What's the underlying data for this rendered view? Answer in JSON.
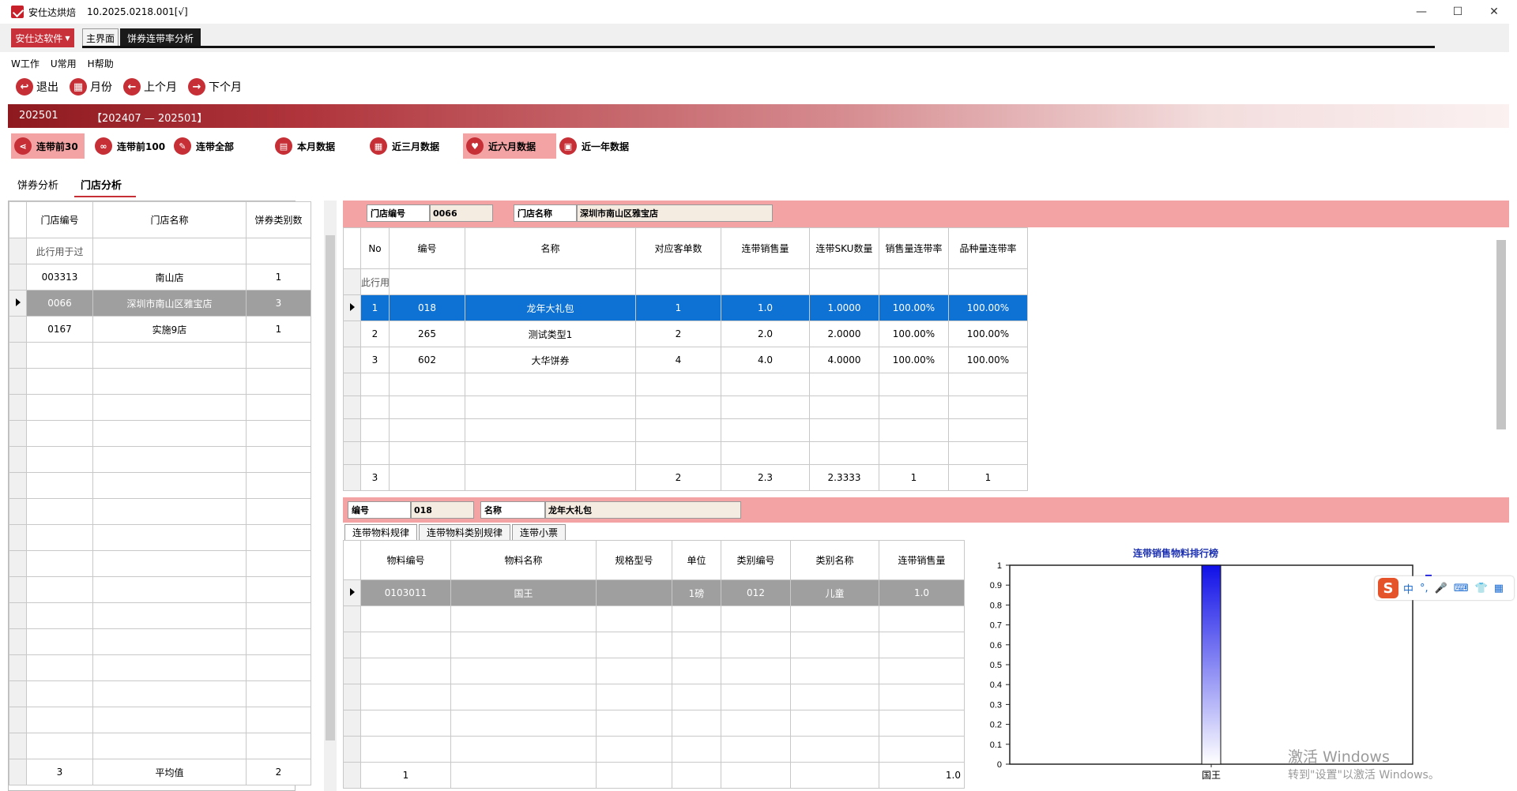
{
  "window": {
    "app_name": "安仕达烘焙",
    "version": "10.2025.0218.001[√]",
    "min": "—",
    "max": "☐",
    "close": "✕"
  },
  "modules": {
    "brand_label": "安仕达软件",
    "home_tab": "主界面",
    "active_tab": "饼券连带率分析"
  },
  "menu": [
    "W工作",
    "U常用",
    "H帮助"
  ],
  "toolbar": {
    "exit": "退出",
    "month": "月份",
    "prev": "上个月",
    "next": "下个月"
  },
  "period": {
    "current": "202501",
    "range": "【202407 — 202501】"
  },
  "filters": {
    "top30": "连带前30",
    "top100": "连带前100",
    "all": "连带全部",
    "this_month": "本月数据",
    "last3": "近三月数据",
    "last6": "近六月数据",
    "last12": "近一年数据",
    "selected": "近六月数据"
  },
  "subtabs": {
    "coupon": "饼券分析",
    "store": "门店分析",
    "active": "门店分析"
  },
  "store_grid": {
    "headers": [
      "门店编号",
      "门店名称",
      "饼券类别数"
    ],
    "filter_text": "此行用于过",
    "rows": [
      {
        "code": "003313",
        "name": "南山店",
        "count": "1"
      },
      {
        "code": "0066",
        "name": "深圳市南山区雅宝店",
        "count": "3"
      },
      {
        "code": "0167",
        "name": "实施9店",
        "count": "1"
      }
    ],
    "footer": {
      "code": "3",
      "name": "平均值",
      "count": "2"
    }
  },
  "store_info": {
    "code_label": "门店编号",
    "code_value": "0066",
    "name_label": "门店名称",
    "name_value": "深圳市南山区雅宝店"
  },
  "coupon_grid": {
    "headers": [
      "No",
      "编号",
      "名称",
      "对应客单数",
      "连带销售量",
      "连带SKU数量",
      "销售量连带率",
      "品种量连带率"
    ],
    "filter_text": "此行用",
    "rows": [
      {
        "no": "1",
        "code": "018",
        "name": "龙年大礼包",
        "orders": "1",
        "qty": "1.0",
        "sku": "1.0000",
        "qty_rate": "100.00%",
        "sku_rate": "100.00%"
      },
      {
        "no": "2",
        "code": "265",
        "name": "测试类型1",
        "orders": "2",
        "qty": "2.0",
        "sku": "2.0000",
        "qty_rate": "100.00%",
        "sku_rate": "100.00%"
      },
      {
        "no": "3",
        "code": "602",
        "name": "大华饼券",
        "orders": "4",
        "qty": "4.0",
        "sku": "4.0000",
        "qty_rate": "100.00%",
        "sku_rate": "100.00%"
      }
    ],
    "footer": {
      "no": "3",
      "orders": "2",
      "qty": "2.3",
      "sku": "2.3333",
      "qty_rate": "1",
      "sku_rate": "1"
    }
  },
  "item_info": {
    "code_label": "编号",
    "code_value": "018",
    "name_label": "名称",
    "name_value": "龙年大礼包"
  },
  "detail_tabs": [
    "连带物料规律",
    "连带物料类别规律",
    "连带小票"
  ],
  "material_grid": {
    "headers": [
      "物料编号",
      "物料名称",
      "规格型号",
      "单位",
      "类别编号",
      "类别名称",
      "连带销售量"
    ],
    "rows": [
      {
        "code": "0103011",
        "name": "国王",
        "spec": "",
        "unit": "1磅",
        "cat_code": "012",
        "cat_name": "儿童",
        "qty": "1.0"
      }
    ],
    "footer": {
      "count": "1",
      "qty": "1.0"
    }
  },
  "chart_data": {
    "type": "bar",
    "title": "连带销售物料排行榜",
    "categories": [
      "国王"
    ],
    "values": [
      1.0
    ],
    "ylim": [
      0,
      1
    ],
    "yticks": [
      "0",
      "0.1",
      "0.2",
      "0.3",
      "0.4",
      "0.5",
      "0.6",
      "0.7",
      "0.8",
      "0.9",
      "1"
    ],
    "legend_position": "top-right",
    "bar_color": "#1010e8"
  },
  "watermark": {
    "line1": "激活 Windows",
    "line2": "转到\"设置\"以激活 Windows。"
  },
  "ime": {
    "logo": "S",
    "items": [
      "中",
      "°,",
      "🎤",
      "⌨",
      "👕",
      "▦"
    ]
  }
}
